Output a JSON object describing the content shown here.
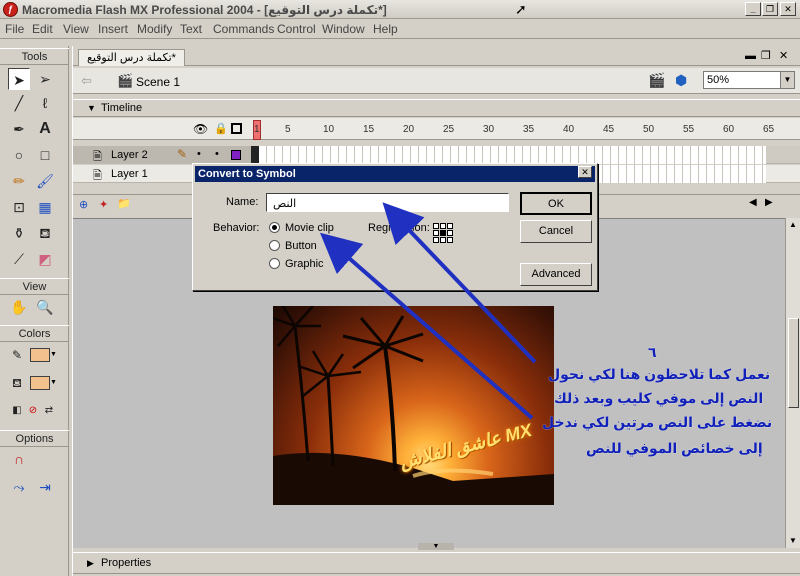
{
  "window": {
    "title": "Macromedia Flash MX Professional 2004 - [تكملة درس التوقيع*]",
    "icon": "flash-app-icon"
  },
  "menu": [
    "File",
    "Edit",
    "View",
    "Insert",
    "Modify",
    "Text",
    "Commands",
    "Control",
    "Window",
    "Help"
  ],
  "tools_panel": {
    "tools_header": "Tools",
    "view_header": "View",
    "colors_header": "Colors",
    "options_header": "Options"
  },
  "document": {
    "tab_label": "تكملة درس التوقيع*",
    "scene_label": "Scene 1",
    "zoom": "50%"
  },
  "timeline": {
    "label": "Timeline",
    "ruler": [
      "1",
      "5",
      "10",
      "15",
      "20",
      "25",
      "30",
      "35",
      "40",
      "45",
      "50",
      "55",
      "60",
      "65"
    ],
    "layers": [
      {
        "name": "Layer 2",
        "selected": true
      },
      {
        "name": "Layer 1",
        "selected": false
      }
    ]
  },
  "dialog": {
    "title": "Convert to Symbol",
    "name_label": "Name:",
    "name_value": "النص",
    "behavior_label": "Behavior:",
    "options": [
      "Movie clip",
      "Button",
      "Graphic"
    ],
    "selected_option": "Movie clip",
    "registration_label": "Registration:",
    "ok": "OK",
    "cancel": "Cancel",
    "advanced": "Advanced"
  },
  "stage": {
    "watermark": "عاشق الفلاش MX",
    "annotation": {
      "number": "٦",
      "lines": [
        "نعمل كما تلاحظون هنا لكي نحول",
        "النص إلى موفي كليب وبعد ذلك",
        "نضغط على النص مرتين لكي ندخل",
        "إلى خصائص الموفي للنص"
      ]
    }
  },
  "properties_label": "Properties",
  "colors": {
    "title_bar": "#0a246a",
    "arrow": "#2030c0",
    "swatch": "#f2c18e",
    "keyframe_marker": "#f07070"
  }
}
